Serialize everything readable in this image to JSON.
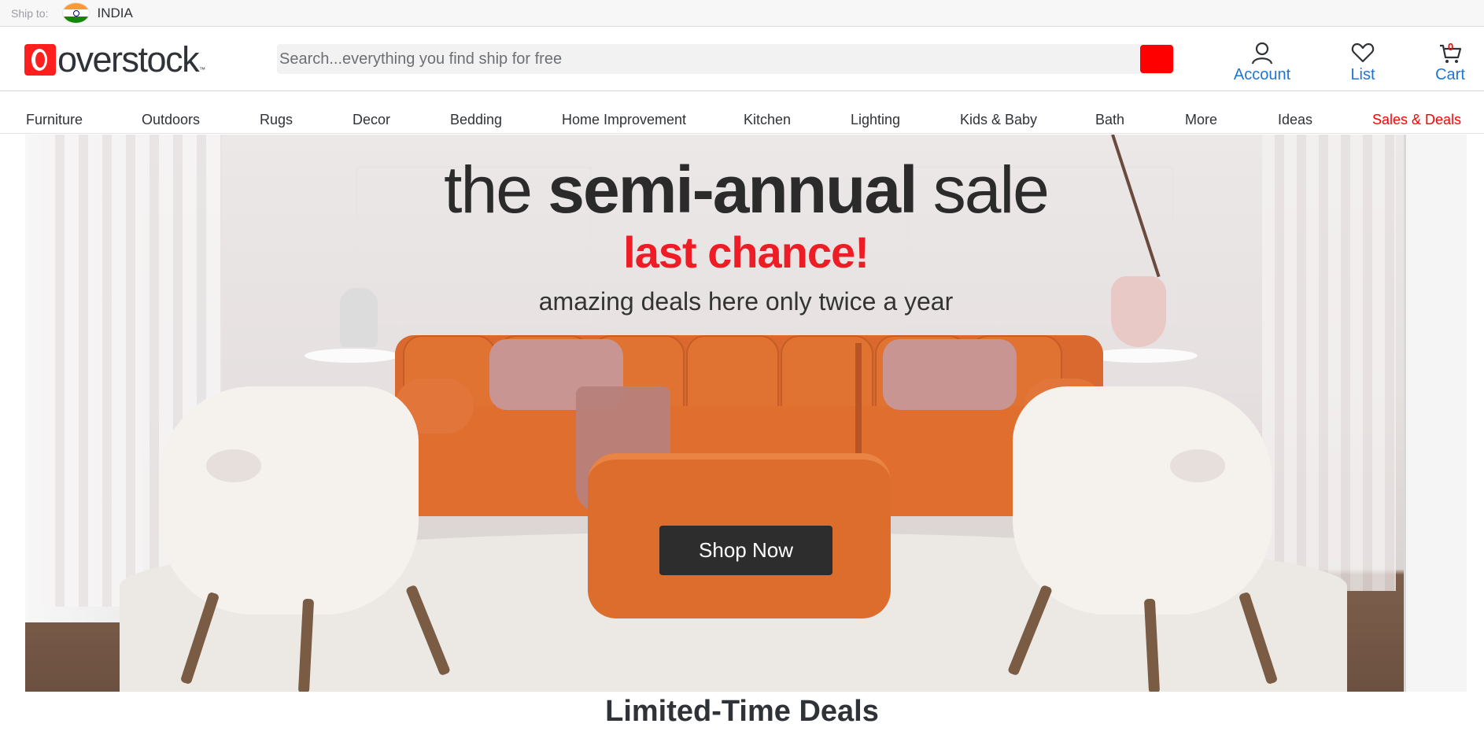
{
  "shipbar": {
    "label": "Ship to:",
    "country": "INDIA",
    "flag_icon": "india-flag-icon"
  },
  "header": {
    "logo_text": "overstock",
    "logo_tm": "™",
    "search": {
      "placeholder": "Search...everything you find ship for free",
      "button_color": "#ff0000"
    },
    "account_label": "Account",
    "list_label": "List",
    "cart_label": "Cart",
    "cart_count": "0",
    "icon_color": "#1f75cf"
  },
  "nav": {
    "items": [
      {
        "label": "Furniture"
      },
      {
        "label": "Outdoors"
      },
      {
        "label": "Rugs"
      },
      {
        "label": "Decor"
      },
      {
        "label": "Bedding"
      },
      {
        "label": "Home Improvement"
      },
      {
        "label": "Kitchen"
      },
      {
        "label": "Lighting"
      },
      {
        "label": "Kids & Baby"
      },
      {
        "label": "Bath"
      },
      {
        "label": "More"
      },
      {
        "label": "Ideas"
      },
      {
        "label": "Sales & Deals",
        "accent": "#ff0000"
      }
    ]
  },
  "hero": {
    "title_light_1": "the ",
    "title_bold": "semi-annual",
    "title_light_2": " sale",
    "subtitle": "last chance!",
    "subtitle_color": "#ee1c24",
    "tagline": "amazing deals here only twice a year",
    "cta_label": "Shop Now"
  },
  "section": {
    "title": "Limited-Time Deals"
  }
}
